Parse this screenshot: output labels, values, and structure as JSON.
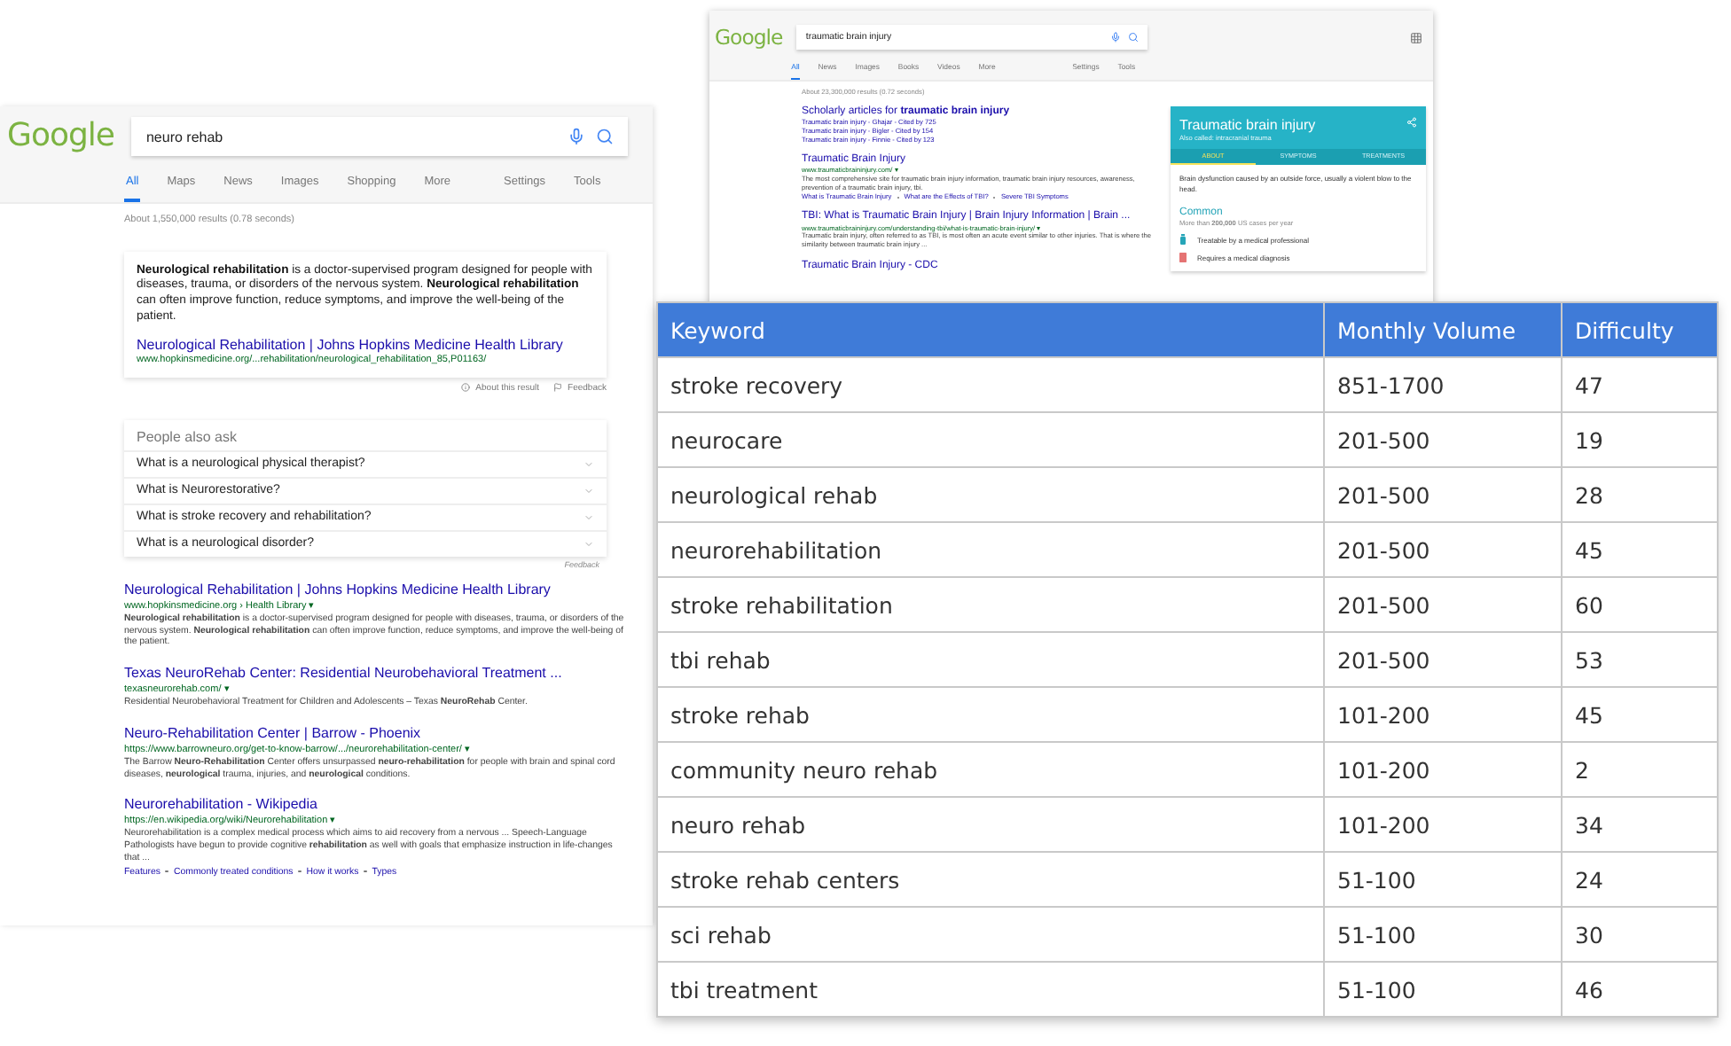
{
  "left_search": {
    "logo": "Google",
    "query": "neuro rehab",
    "tabs": [
      {
        "label": "All",
        "selected": true
      },
      {
        "label": "Maps",
        "selected": false
      },
      {
        "label": "News",
        "selected": false
      },
      {
        "label": "Images",
        "selected": false
      },
      {
        "label": "Shopping",
        "selected": false
      },
      {
        "label": "More",
        "selected": false
      }
    ],
    "tools": [
      "Settings",
      "Tools"
    ],
    "stats": "About 1,550,000 results (0.78 seconds)",
    "featured": {
      "text": "**Neurological rehabilitation** is a doctor-supervised program designed for people with diseases, trauma, or disorders of the nervous system. **Neurological rehabilitation** can often improve function, reduce symptoms, and improve the well-being of the patient.",
      "title": "Neurological Rehabilitation | Johns Hopkins Medicine Health Library",
      "url": "www.hopkinsmedicine.org/...rehabilitation/neurological_rehabilitation_85,P01163/"
    },
    "featured_footer": {
      "about": "About this result",
      "feedback": "Feedback"
    },
    "people_also_ask": {
      "heading": "People also ask",
      "questions": [
        "What is a neurological physical therapist?",
        "What is Neurorestorative?",
        "What is stroke recovery and rehabilitation?",
        "What is a neurological disorder?"
      ],
      "feedback": "Feedback"
    },
    "results": [
      {
        "title": "Neurological Rehabilitation | Johns Hopkins Medicine Health Library",
        "url": "www.hopkinsmedicine.org › Health Library ▾",
        "snippet": "**Neurological rehabilitation** is a doctor-supervised program designed for people with diseases, trauma, or disorders of the nervous system. **Neurological rehabilitation** can often improve function, reduce symptoms, and improve the well-being of the patient."
      },
      {
        "title": "Texas NeuroRehab Center: Residential Neurobehavioral Treatment ...",
        "url": "texasneurorehab.com/ ▾",
        "snippet": "Residential Neurobehavioral Treatment for Children and Adolescents – Texas **NeuroRehab** Center."
      },
      {
        "title": "Neuro-Rehabilitation Center | Barrow - Phoenix",
        "url": "https://www.barrowneuro.org/get-to-know-barrow/.../neurorehabilitation-center/ ▾",
        "snippet": "The Barrow **Neuro-Rehabilitation** Center offers unsurpassed **neuro-rehabilitation** for people with brain and spinal cord diseases, **neurological** trauma, injuries, and **neurological** conditions."
      },
      {
        "title": "Neurorehabilitation - Wikipedia",
        "url": "https://en.wikipedia.org/wiki/Neurorehabilitation ▾",
        "snippet": "Neurorehabilitation is a complex medical process which aims to aid recovery from a nervous ... Speech-Language Pathologists have begun to provide cognitive **rehabilitation** as well with goals that emphasize instruction in life-changes that ...",
        "links": [
          "Features",
          "Commonly treated conditions",
          "How it works",
          "Types"
        ]
      }
    ]
  },
  "top_search": {
    "logo": "Google",
    "query": "traumatic brain injury",
    "tabs": [
      {
        "label": "All",
        "selected": true
      },
      {
        "label": "News",
        "selected": false
      },
      {
        "label": "Images",
        "selected": false
      },
      {
        "label": "Books",
        "selected": false
      },
      {
        "label": "Videos",
        "selected": false
      },
      {
        "label": "More",
        "selected": false
      }
    ],
    "tools": [
      "Settings",
      "Tools"
    ],
    "stats": "About 23,300,000 results (0.72 seconds)",
    "scholarly": {
      "title": "Scholarly articles for **traumatic brain injury**",
      "items": [
        "Traumatic brain injury - Ghajar - Cited by 725",
        "Traumatic brain injury - Bigler - Cited by 154",
        "Traumatic brain injury - Finnie - Cited by 123"
      ]
    },
    "results": [
      {
        "title": "Traumatic Brain Injury",
        "url": "www.traumaticbraininjury.com/ ▾",
        "snippet": "The most comprehensive site for traumatic brain injury information, traumatic brain injury resources, awareness, prevention of a traumatic brain injury, tbi.",
        "links": [
          "What is Traumatic Brain Injury",
          "What are the Effects of TBI?",
          "Severe TBI Symptoms"
        ]
      },
      {
        "title": "TBI: What is Traumatic Brain Injury | Brain Injury Information | Brain ...",
        "url": "www.traumaticbraininjury.com/understanding-tbi/what-is-traumatic-brain-injury/ ▾",
        "snippet": "Traumatic brain injury, often referred to as TBI, is most often an acute event similar to other injuries. That is where the similarity between traumatic brain injury ..."
      },
      {
        "title": "Traumatic Brain Injury - CDC"
      }
    ],
    "knowledge_panel": {
      "title": "Traumatic brain injury",
      "subtitle": "Also called: intracranial trauma",
      "tabs": [
        {
          "label": "ABOUT",
          "selected": true
        },
        {
          "label": "SYMPTOMS",
          "selected": false
        },
        {
          "label": "TREATMENTS",
          "selected": false
        }
      ],
      "description": "Brain dysfunction caused by an outside force, usually a violent blow to the head.",
      "section": "Common",
      "section_note": "More than **200,000** US cases per year",
      "facts": [
        {
          "kind": "treatable",
          "text": "Treatable by a medical professional"
        },
        {
          "kind": "diagnosis",
          "text": "Requires a medical diagnosis"
        }
      ]
    }
  },
  "keyword_table": {
    "columns": [
      "Keyword",
      "Monthly Volume",
      "Difficulty"
    ],
    "rows": [
      [
        "stroke recovery",
        "851-1700",
        "47"
      ],
      [
        "neurocare",
        "201-500",
        "19"
      ],
      [
        "neurological rehab",
        "201-500",
        "28"
      ],
      [
        "neurorehabilitation",
        "201-500",
        "45"
      ],
      [
        "stroke rehabilitation",
        "201-500",
        "60"
      ],
      [
        "tbi rehab",
        "201-500",
        "53"
      ],
      [
        "stroke rehab",
        "101-200",
        "45"
      ],
      [
        "community neuro rehab",
        "101-200",
        "2"
      ],
      [
        "neuro rehab",
        "101-200",
        "34"
      ],
      [
        "stroke rehab centers",
        "51-100",
        "24"
      ],
      [
        "sci rehab",
        "51-100",
        "30"
      ],
      [
        "tbi treatment",
        "51-100",
        "46"
      ]
    ]
  }
}
